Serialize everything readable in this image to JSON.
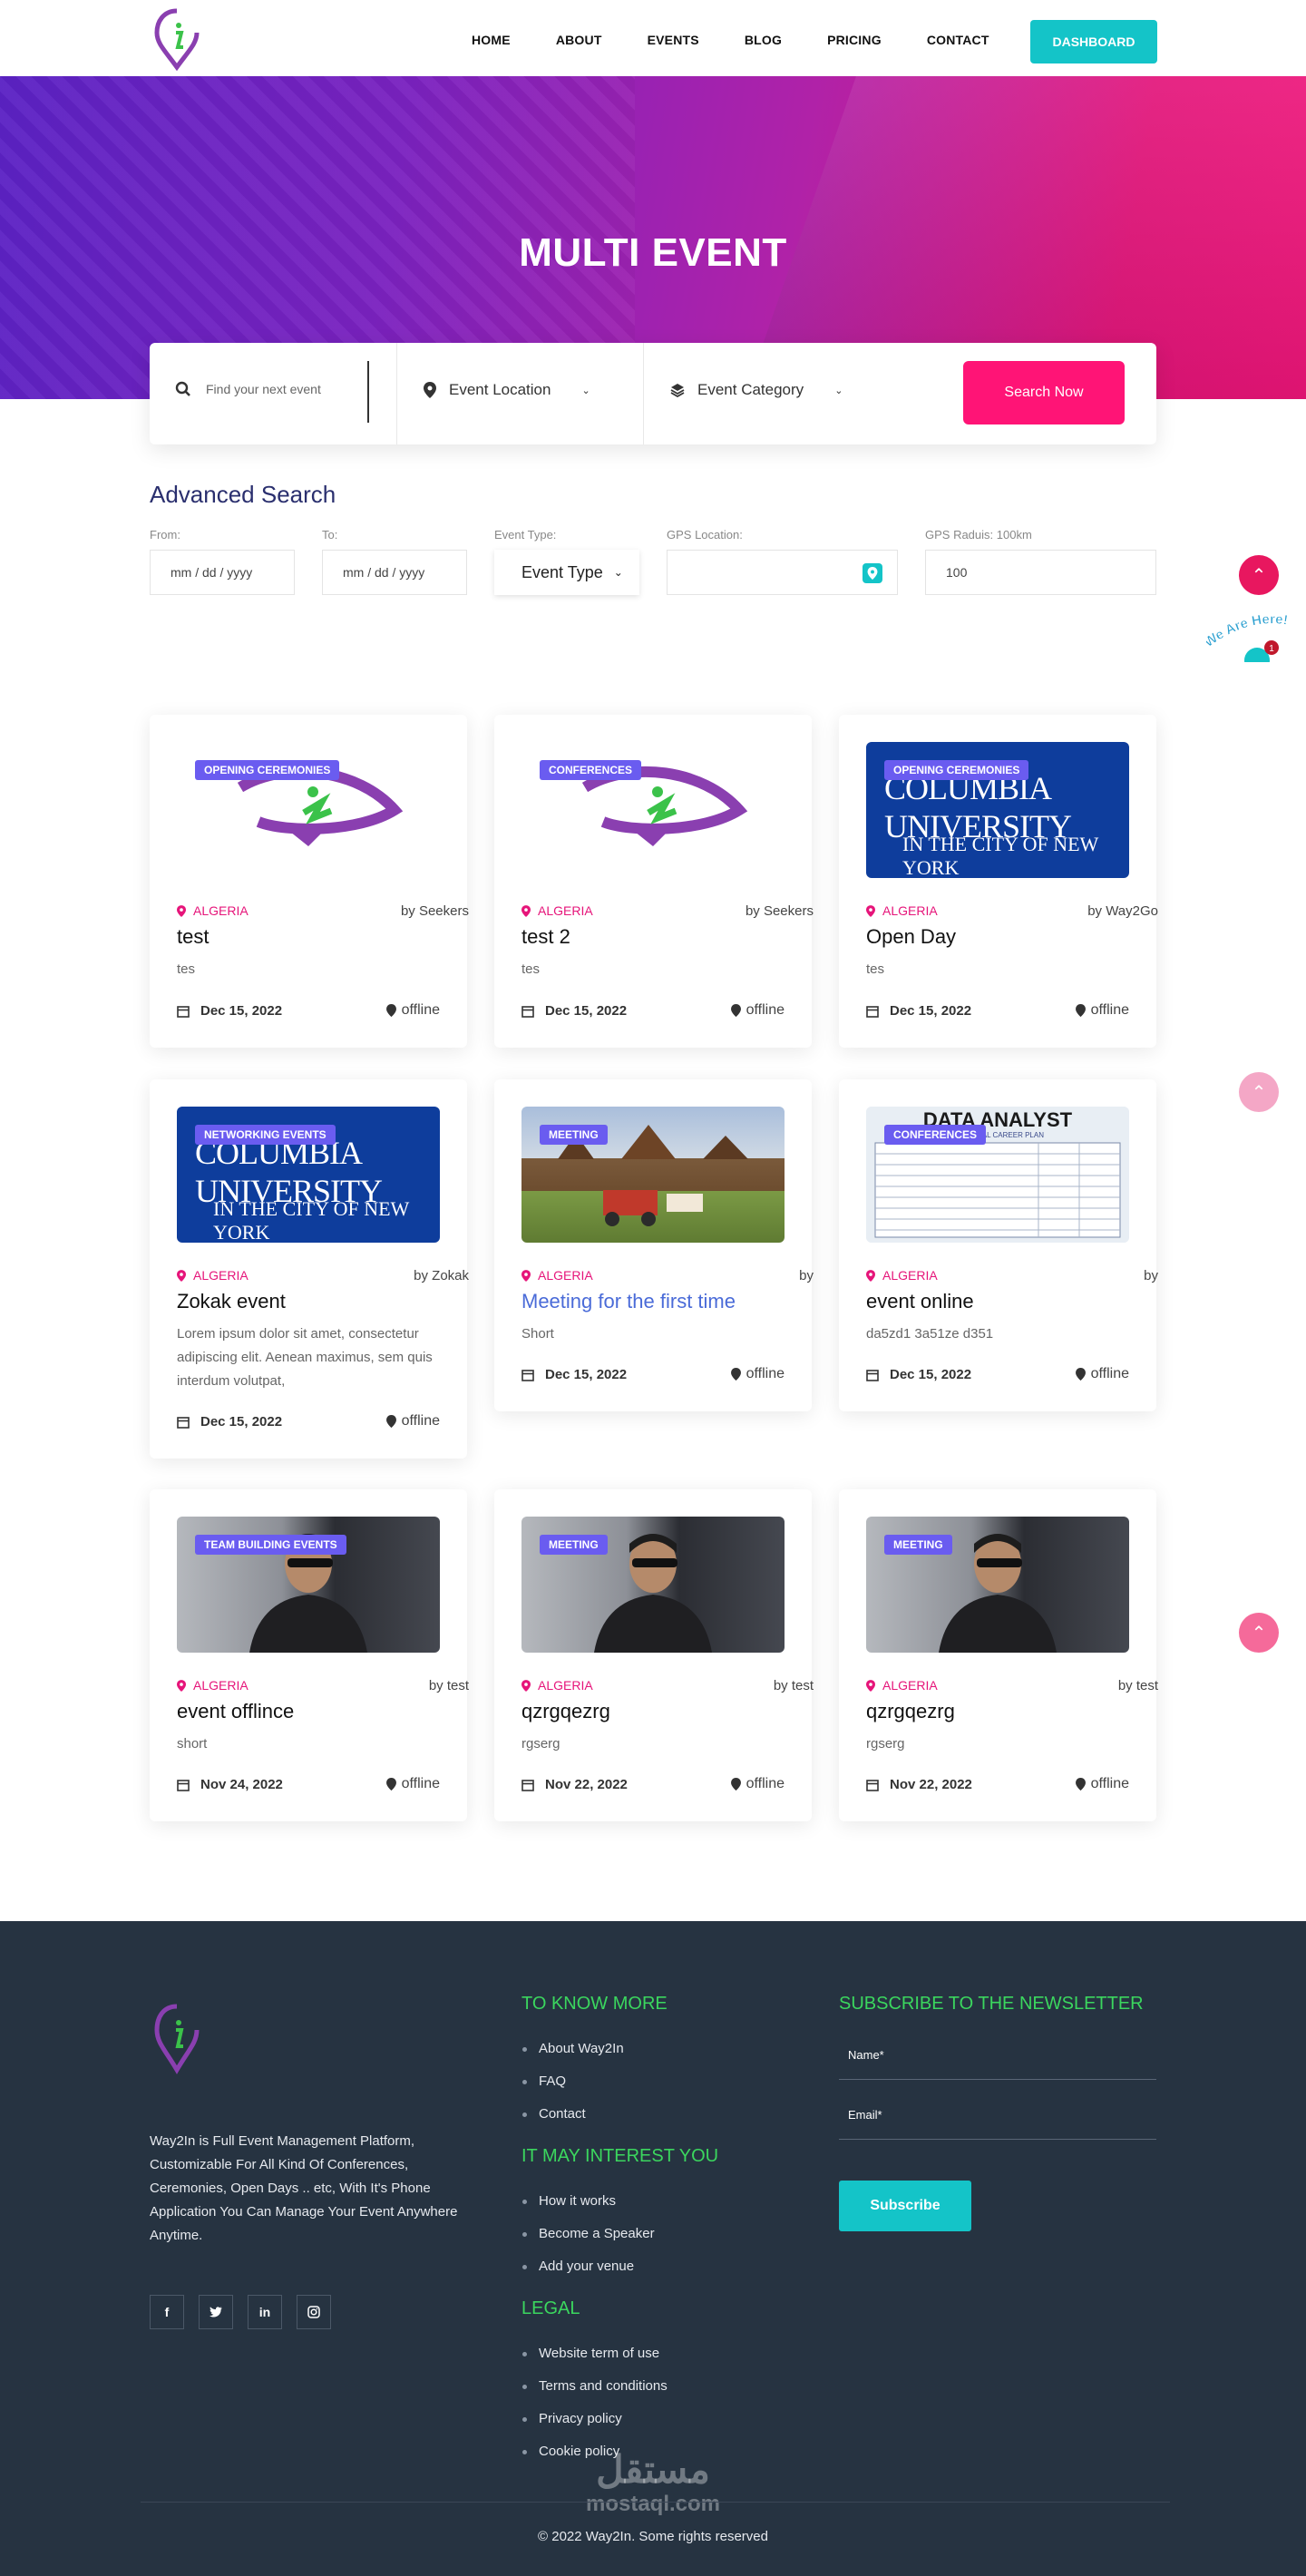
{
  "nav": {
    "items": [
      "HOME",
      "ABOUT",
      "EVENTS",
      "BLOG",
      "PRICING",
      "CONTACT"
    ],
    "dashboard": "DASHBOARD"
  },
  "hero": {
    "title": "MULTI EVENT"
  },
  "search": {
    "placeholder": "Find your next event",
    "location": "Event Location",
    "category": "Event Category",
    "button": "Search Now"
  },
  "advanced": {
    "title": "Advanced Search",
    "from_label": "From:",
    "to_label": "To:",
    "type_label": "Event Type:",
    "gps_label": "GPS Location:",
    "radius_label": "GPS Raduis: 100km",
    "from_value": "mm / dd / yyyy",
    "to_value": "mm / dd / yyyy",
    "type_value": "Event Type",
    "radius_value": "100"
  },
  "float_text": "We Are Here!",
  "float_count": "1",
  "cards": [
    {
      "badge": "OPENING CEREMONIES",
      "location": "ALGERIA",
      "by": "by Seekers",
      "title": "test",
      "desc": "tes",
      "date": "Dec 15, 2022",
      "mode": "offline"
    },
    {
      "badge": "CONFERENCES",
      "location": "ALGERIA",
      "by": "by Seekers",
      "title": "test 2",
      "desc": "tes",
      "date": "Dec 15, 2022",
      "mode": "offline"
    },
    {
      "badge": "OPENING CEREMONIES",
      "location": "ALGERIA",
      "by": "by Way2Go",
      "title": "Open Day",
      "desc": "tes",
      "date": "Dec 15, 2022",
      "mode": "offline"
    },
    {
      "badge": "NETWORKING EVENTS",
      "location": "ALGERIA",
      "by": "by Zokak",
      "title": "Zokak event",
      "desc": "Lorem ipsum dolor sit amet, consectetur adipiscing elit. Aenean maximus, sem quis interdum volutpat,",
      "date": "Dec 15, 2022",
      "mode": "offline"
    },
    {
      "badge": "MEETING",
      "location": "ALGERIA",
      "by": "by",
      "title": "Meeting for the first time",
      "desc": "Short",
      "date": "Dec 15, 2022",
      "mode": "offline"
    },
    {
      "badge": "CONFERENCES",
      "location": "ALGERIA",
      "by": "by",
      "title": "event online",
      "desc": "da5zd1 3a51ze d351",
      "date": "Dec 15, 2022",
      "mode": "offline"
    },
    {
      "badge": "TEAM BUILDING EVENTS",
      "location": "ALGERIA",
      "by": "by test",
      "title": "event offlince",
      "desc": "short",
      "date": "Nov 24, 2022",
      "mode": "offline"
    },
    {
      "badge": "MEETING",
      "location": "ALGERIA",
      "by": "by test",
      "title": "qzrgqezrg",
      "desc": "rgserg",
      "date": "Nov 22, 2022",
      "mode": "offline"
    },
    {
      "badge": "MEETING",
      "location": "ALGERIA",
      "by": "by test",
      "title": "qzrgqezrg",
      "desc": "rgserg",
      "date": "Nov 22, 2022",
      "mode": "offline"
    }
  ],
  "columbia": {
    "line1": "COLUMBIA UNIVERSITY",
    "line2": "IN THE CITY OF NEW YORK"
  },
  "data_analyst": {
    "title": "DATA ANALYST",
    "subtitle": "PERSONAL CAREER PLAN"
  },
  "footer": {
    "about": "Way2In is Full Event Management Platform, Customizable For All Kind Of Conferences, Ceremonies, Open Days .. etc, With It's Phone Application You Can Manage Your Event Anywhere Anytime.",
    "know_more": "TO KNOW MORE",
    "know_links": [
      "About Way2In",
      "FAQ",
      "Contact"
    ],
    "interest": "IT MAY INTEREST YOU",
    "interest_links": [
      "How it works",
      "Become a Speaker",
      "Add your venue"
    ],
    "legal": "LEGAL",
    "legal_links": [
      "Website term of use",
      "Terms and conditions",
      "Privacy policy",
      "Cookie policy"
    ],
    "newsletter": "SUBSCRIBE TO THE NEWSLETTER",
    "name_label": "Name*",
    "email_label": "Email*",
    "subscribe": "Subscribe",
    "copyright": "© 2022  Way2In. Some rights reserved",
    "watermark_ar": "مستقل",
    "watermark_en": "mostaql.com"
  },
  "colors": {
    "accent": "#14c4c8",
    "pink": "#ff1476",
    "purple": "#5b22c4",
    "footer": "#263341"
  }
}
